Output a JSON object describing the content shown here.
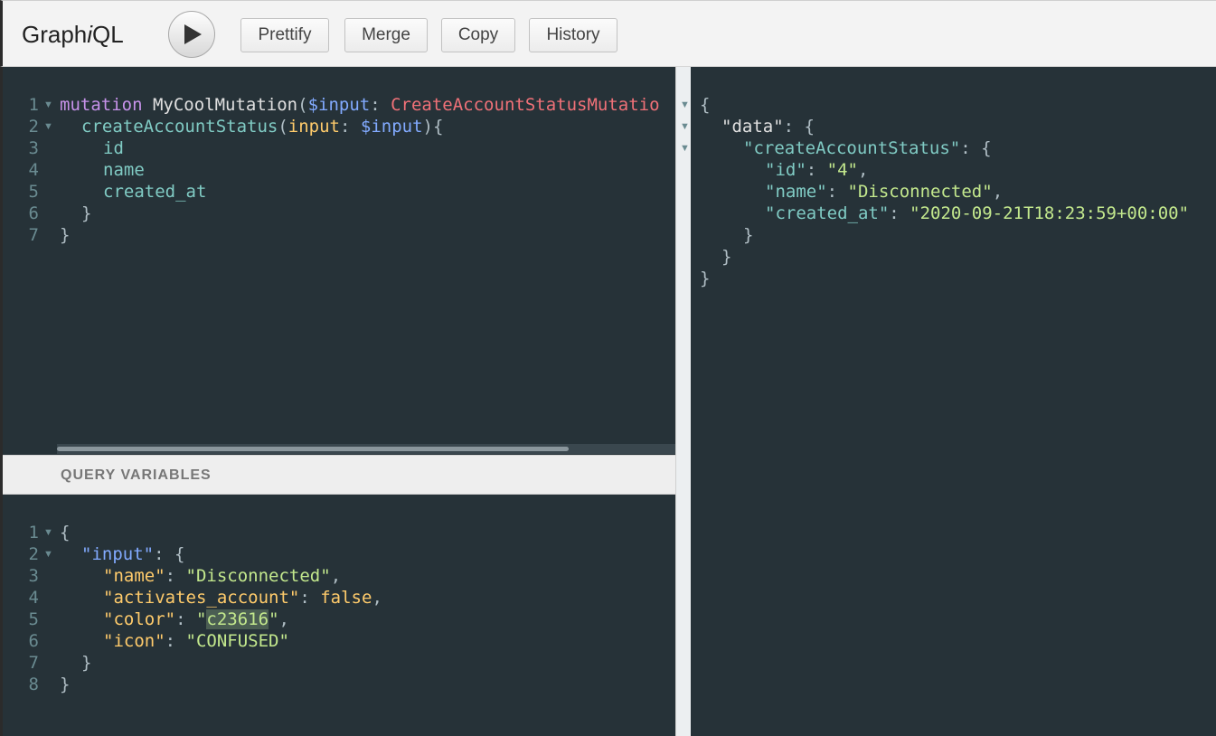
{
  "toolbar": {
    "title_pre": "Graph",
    "title_i": "i",
    "title_post": "QL",
    "prettify": "Prettify",
    "merge": "Merge",
    "copy": "Copy",
    "history": "History"
  },
  "query": {
    "line_numbers": [
      "1",
      "2",
      "3",
      "4",
      "5",
      "6",
      "7"
    ],
    "l1": {
      "kw": "mutation",
      "name": "MyCoolMutation",
      "p1": "(",
      "var": "$input",
      "colon": ": ",
      "type": "CreateAccountStatusMutatio"
    },
    "l2": {
      "field": "createAccountStatus",
      "p1": "(",
      "arg": "input",
      "colon": ": ",
      "var": "$input",
      "p2": "){"
    },
    "l3": "id",
    "l4": "name",
    "l5": "created_at",
    "l6": "}",
    "l7": "}"
  },
  "variables": {
    "header": "QUERY VARIABLES",
    "line_numbers": [
      "1",
      "2",
      "3",
      "4",
      "5",
      "6",
      "7",
      "8"
    ],
    "l1": "{",
    "l2": {
      "key": "\"input\"",
      "rest": ": {"
    },
    "l3": {
      "key": "\"name\"",
      "sep": ": ",
      "val": "\"Disconnected\"",
      "end": ","
    },
    "l4": {
      "key": "\"activates_account\"",
      "sep": ": ",
      "val": "false",
      "end": ","
    },
    "l5": {
      "key": "\"color\"",
      "sep": ": ",
      "q1": "\"",
      "sel": "c23616",
      "q2": "\"",
      "end": ","
    },
    "l6": {
      "key": "\"icon\"",
      "sep": ": ",
      "val": "\"CONFUSED\""
    },
    "l7": "}",
    "l8": "}"
  },
  "result": {
    "l1": "{",
    "l2": {
      "key": "\"data\"",
      "rest": ": {"
    },
    "l3": {
      "key": "\"createAccountStatus\"",
      "rest": ": {"
    },
    "l4": {
      "key": "\"id\"",
      "sep": ": ",
      "val": "\"4\"",
      "end": ","
    },
    "l5": {
      "key": "\"name\"",
      "sep": ": ",
      "val": "\"Disconnected\"",
      "end": ","
    },
    "l6": {
      "key": "\"created_at\"",
      "sep": ": ",
      "val": "\"2020-09-21T18:23:59+00:00\""
    },
    "l7": "}",
    "l8": "}",
    "l9": "}"
  }
}
